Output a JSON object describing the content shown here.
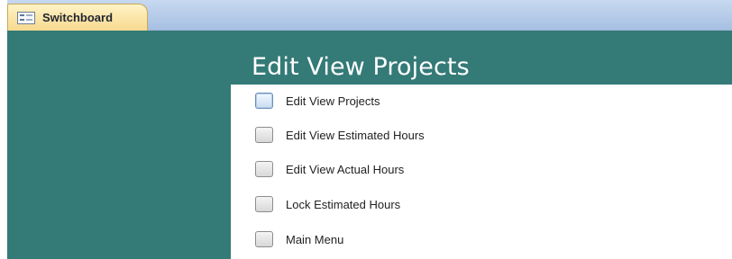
{
  "document_tab": {
    "icon": "form-icon",
    "label": "Switchboard"
  },
  "switchboard": {
    "title": "Edit View Projects",
    "items": [
      {
        "label": "Edit View Projects",
        "icon": "command-button"
      },
      {
        "label": "Edit View Estimated Hours",
        "icon": "command-button"
      },
      {
        "label": "Edit View Actual Hours",
        "icon": "command-button"
      },
      {
        "label": "Lock Estimated Hours",
        "icon": "command-button"
      },
      {
        "label": "Main Menu",
        "icon": "command-button"
      }
    ]
  },
  "colors": {
    "form_background": "#347a77",
    "tab_background": "#f7d98f",
    "tabbar_background": "#a7c0e2"
  }
}
